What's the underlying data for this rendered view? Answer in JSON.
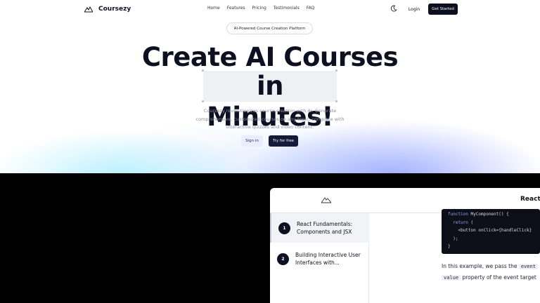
{
  "nav": {
    "brand": "Coursezy",
    "links": [
      "Home",
      "Features",
      "Pricing",
      "Testimonials",
      "FAQ"
    ],
    "login": "Login",
    "cta": "Get Started"
  },
  "hero": {
    "badge": "AI-Powered Course Creation Platform",
    "headline_line1": "Create AI Courses",
    "headline_line2": "in Minutes!",
    "description": "Coursezy revolutionizes course creation with AI. Generate comprehensive, customized courses on any topic, complete with interactive quizzes and video content.",
    "signin": "Sign in",
    "try_free": "Try for free"
  },
  "app": {
    "title": "React",
    "lessons": [
      {
        "num": "1",
        "title": "React Fundamentals: Components and JSX"
      },
      {
        "num": "2",
        "title": "Building Interactive User Interfaces with..."
      }
    ],
    "code": {
      "line1_kw": "function",
      "line1_rest": " MyComponent() {",
      "line2_kw": "return",
      "line2_rest": " (",
      "line3": "<button onClick={handleClick}",
      "line4": ");",
      "line5": "}"
    },
    "text_line1_pre": "In this example, we pass the ",
    "text_line1_code": "event",
    "text_line2_code": "value",
    "text_line2_post": " property of the event target"
  },
  "icons": {
    "brand": "mountain-logo-icon",
    "theme": "moon-icon"
  }
}
